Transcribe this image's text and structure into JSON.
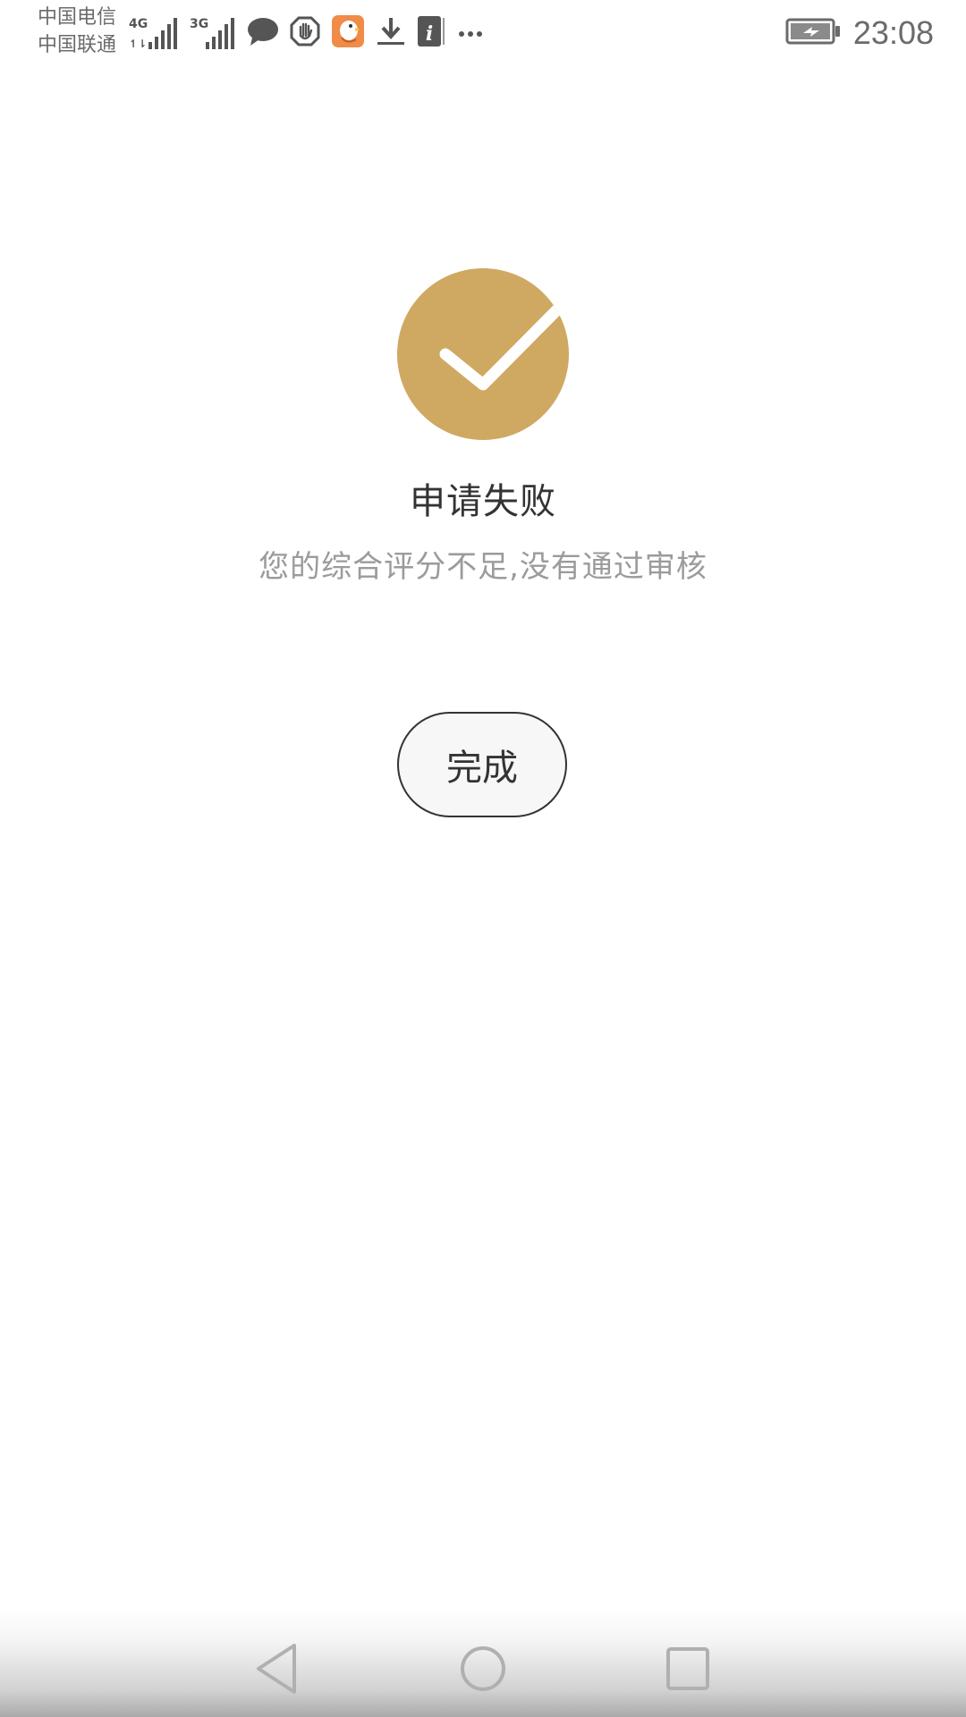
{
  "status_bar": {
    "carrier_1": "中国电信",
    "carrier_2": "中国联通",
    "signal_1_type": "4G",
    "signal_2_type": "3G",
    "time": "23:08",
    "icons": [
      "signal-4g-icon",
      "signal-3g-icon",
      "chat-bubble-icon",
      "hand-stop-icon",
      "app-bird-icon",
      "download-icon",
      "info-icon",
      "more-dots-icon",
      "battery-charging-icon"
    ]
  },
  "result": {
    "title": "申请失败",
    "subtitle": "您的综合评分不足,没有通过审核",
    "icon": "checkmark-circle-icon",
    "icon_color": "#cfa862"
  },
  "actions": {
    "done_label": "完成"
  },
  "navigation": {
    "buttons": [
      "back-icon",
      "home-icon",
      "recent-apps-icon"
    ]
  },
  "colors": {
    "accent": "#cfa862",
    "title_text": "#333333",
    "subtitle_text": "#9b9b9b",
    "button_border": "#333333"
  }
}
